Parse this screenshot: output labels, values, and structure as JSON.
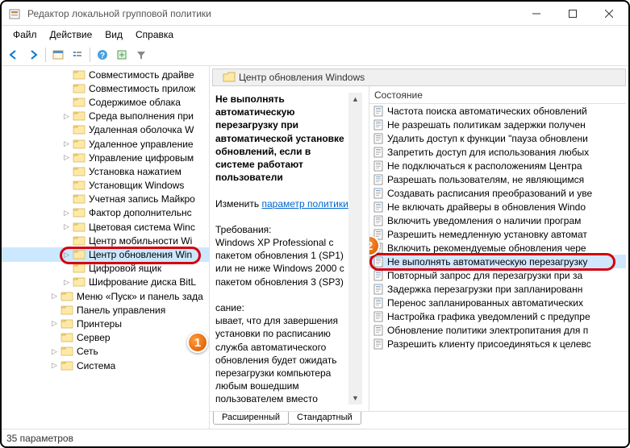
{
  "window": {
    "title": "Редактор локальной групповой политики"
  },
  "menubar": [
    "Файл",
    "Действие",
    "Вид",
    "Справка"
  ],
  "tree": [
    {
      "indent": 75,
      "exp": "",
      "label": "Совместимость драйве"
    },
    {
      "indent": 75,
      "exp": "",
      "label": "Совместимость прилож"
    },
    {
      "indent": 75,
      "exp": "",
      "label": "Содержимое облака"
    },
    {
      "indent": 75,
      "exp": ">",
      "label": "Среда выполнения при"
    },
    {
      "indent": 75,
      "exp": "",
      "label": "Удаленная оболочка W"
    },
    {
      "indent": 75,
      "exp": ">",
      "label": "Удаленное управление"
    },
    {
      "indent": 75,
      "exp": ">",
      "label": "Управление цифровым"
    },
    {
      "indent": 75,
      "exp": "",
      "label": "Установка нажатием"
    },
    {
      "indent": 75,
      "exp": "",
      "label": "Установщик Windows"
    },
    {
      "indent": 75,
      "exp": "",
      "label": "Учетная запись Майкро"
    },
    {
      "indent": 75,
      "exp": ">",
      "label": "Фактор дополнительнс"
    },
    {
      "indent": 75,
      "exp": ">",
      "label": "Цветовая система Winc"
    },
    {
      "indent": 75,
      "exp": "",
      "label": "Центр мобильности Wi"
    },
    {
      "indent": 75,
      "exp": ">",
      "label": "Центр обновления Win",
      "sel": true
    },
    {
      "indent": 75,
      "exp": "",
      "label": "Цифровой ящик"
    },
    {
      "indent": 75,
      "exp": ">",
      "label": "Шифрование диска BitL"
    },
    {
      "indent": 60,
      "exp": ">",
      "label": "Меню «Пуск» и панель зада"
    },
    {
      "indent": 60,
      "exp": "",
      "label": "Панель управления"
    },
    {
      "indent": 60,
      "exp": ">",
      "label": "Принтеры"
    },
    {
      "indent": 60,
      "exp": "",
      "label": "Сервер"
    },
    {
      "indent": 60,
      "exp": ">",
      "label": "Сеть"
    },
    {
      "indent": 60,
      "exp": ">",
      "label": "Система"
    }
  ],
  "right": {
    "header": "Центр обновления Windows",
    "desc": {
      "title": "Не выполнять автоматическую перезагрузку при автоматической установке обновлений, если в системе работают пользователи",
      "edit_label": "Изменить",
      "edit_link": "параметр политики",
      "req_label": "Требования:",
      "req_text": "Windows XP Professional с пакетом обновления 1 (SP1) или не ниже Windows 2000 с пакетом обновления 3 (SP3)",
      "desc_label": "сание:",
      "desc_text": "ывает, что для завершения установки по расписанию служба автоматического обновления будет ожидать перезагрузки компьютера любым вошедшим пользователем вместо автоматической перезагрузки компьютера."
    },
    "col_header": "Состояние",
    "items": [
      "Частота поиска автоматических обновлений",
      "Не разрешать политикам задержки получен",
      "Удалить доступ к функции \"пауза обновлени",
      "Запретить доступ для использования любых",
      "Не подключаться к расположениям Центра",
      "Разрешать пользователям, не являющимся",
      "Создавать расписания преобразований и уве",
      "Не включать драйверы в обновления Windo",
      "Включить уведомления о наличии програм",
      "Разрешить немедленную установку автомат",
      "Включить рекомендуемые обновления чере",
      "Не выполнять автоматическую перезагрузку",
      "Повторный запрос для перезагрузки при за",
      "Задержка перезагрузки при запланированн",
      "Перенос запланированных автоматических",
      "Настройка графика уведомлений с предупре",
      "Обновление политики электропитания для п",
      "Разрешить клиенту присоединяться к целевс"
    ],
    "selected_index": 11
  },
  "tabs": [
    "Расширенный",
    "Стандартный"
  ],
  "statusbar": "35 параметров",
  "callouts": {
    "c1": "1",
    "c2": "2"
  }
}
